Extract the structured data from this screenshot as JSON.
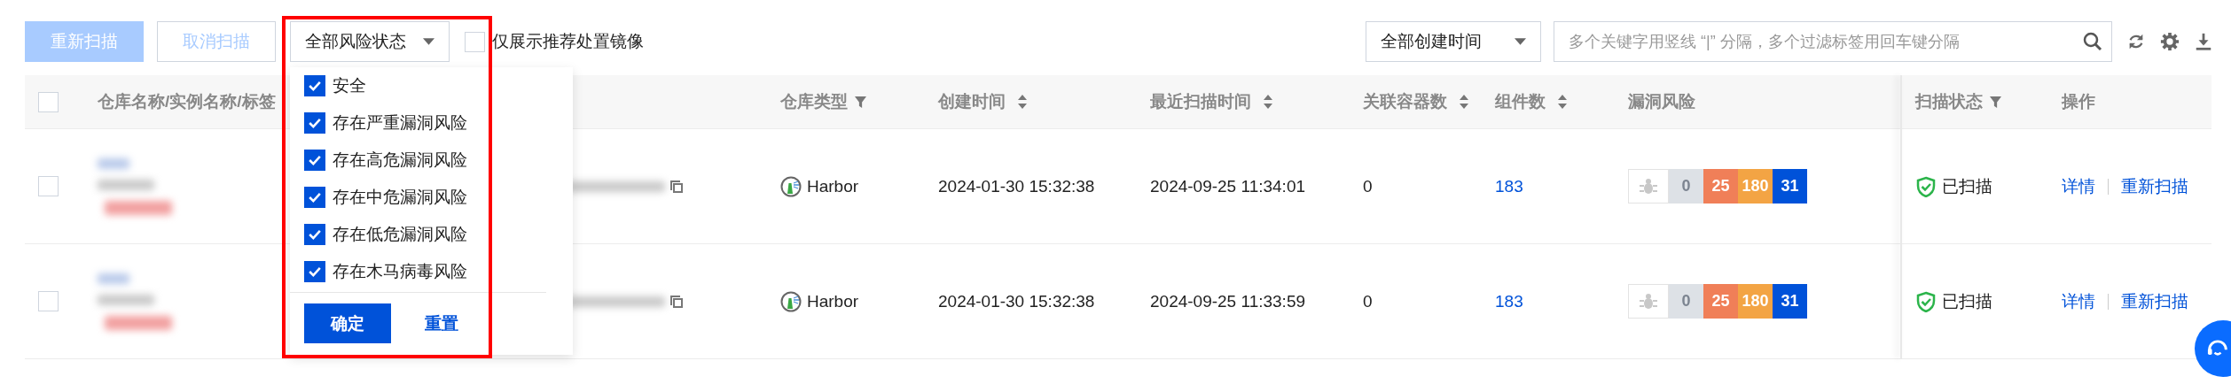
{
  "toolbar": {
    "buttons": [
      {
        "label": "重新扫描",
        "kind": "primary",
        "disabled": true
      },
      {
        "label": "取消扫描",
        "kind": "secondary",
        "disabled": true
      }
    ],
    "risk_filter": {
      "value": "全部风险状态",
      "expanded": true,
      "options": [
        {
          "label": "安全",
          "checked": true
        },
        {
          "label": "存在严重漏洞风险",
          "checked": true
        },
        {
          "label": "存在高危漏洞风险",
          "checked": true
        },
        {
          "label": "存在中危漏洞风险",
          "checked": true
        },
        {
          "label": "存在低危漏洞风险",
          "checked": true
        },
        {
          "label": "存在木马病毒风险",
          "checked": true
        }
      ],
      "confirm": "确定",
      "reset": "重置"
    },
    "recommended_only": {
      "label": "仅展示推荐处置镜像",
      "checked": false
    },
    "time_filter": {
      "value": "全部创建时间"
    },
    "search": {
      "placeholder": "多个关键字用竖线 “|” 分隔，多个过滤标签用回车键分隔"
    }
  },
  "table": {
    "all_selected": false,
    "columns": [
      {
        "label": "仓库名称/实例名称/标签",
        "sortable": false,
        "filterable": false
      },
      {
        "label": "仓库类型",
        "sortable": false,
        "filterable": true
      },
      {
        "label": "创建时间",
        "sortable": true,
        "filterable": false
      },
      {
        "label": "最近扫描时间",
        "sortable": true,
        "filterable": false
      },
      {
        "label": "关联容器数",
        "sortable": true,
        "filterable": false
      },
      {
        "label": "组件数",
        "sortable": true,
        "filterable": false
      },
      {
        "label": "漏洞风险",
        "sortable": false,
        "filterable": false
      },
      {
        "label": "扫描状态",
        "sortable": false,
        "filterable": true
      },
      {
        "label": "操作",
        "sortable": false,
        "filterable": false
      }
    ],
    "rows": [
      {
        "selected": false,
        "registry_type": "Harbor",
        "created": "2024-01-30 15:32:38",
        "last_scan": "2024-09-25 11:34:01",
        "containers": "0",
        "components": "183",
        "vulnerabilities": [
          {
            "count": "0",
            "color": "#dde1e6"
          },
          {
            "count": "25",
            "color": "#f07f58"
          },
          {
            "count": "180",
            "color": "#f3a444"
          },
          {
            "count": "31",
            "color": "#0052d9"
          }
        ],
        "status": "已扫描",
        "actions": [
          "详情",
          "重新扫描"
        ]
      },
      {
        "selected": false,
        "registry_type": "Harbor",
        "created": "2024-01-30 15:32:38",
        "last_scan": "2024-09-25 11:33:59",
        "containers": "0",
        "components": "183",
        "vulnerabilities": [
          {
            "count": "0",
            "color": "#dde1e6"
          },
          {
            "count": "25",
            "color": "#f07f58"
          },
          {
            "count": "180",
            "color": "#f3a444"
          },
          {
            "count": "31",
            "color": "#0052d9"
          }
        ],
        "status": "已扫描",
        "actions": [
          "详情",
          "重新扫描"
        ]
      }
    ]
  }
}
